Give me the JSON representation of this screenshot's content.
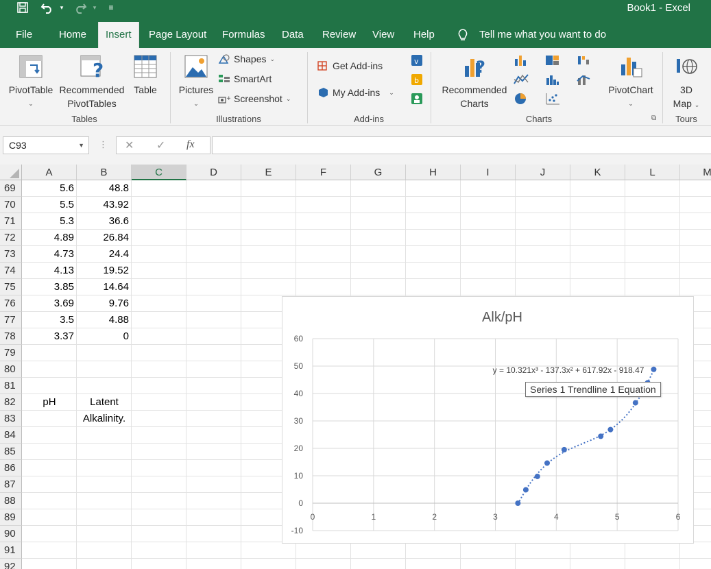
{
  "app": {
    "title": "Book1  -  Excel",
    "accent": "#217346"
  },
  "quick_access": {
    "save_icon": "save-icon",
    "undo_icon": "undo-icon",
    "redo_icon": "redo-icon",
    "customize_icon": "customize-icon"
  },
  "tabs": [
    {
      "label": "File"
    },
    {
      "label": "Home"
    },
    {
      "label": "Insert"
    },
    {
      "label": "Page Layout"
    },
    {
      "label": "Formulas"
    },
    {
      "label": "Data"
    },
    {
      "label": "Review"
    },
    {
      "label": "View"
    },
    {
      "label": "Help"
    }
  ],
  "active_tab": "Insert",
  "tell_me": "Tell me what you want to do",
  "ribbon": {
    "tables": {
      "group_label": "Tables",
      "pivot_table": "PivotTable",
      "recommended_pivot_1": "Recommended",
      "recommended_pivot_2": "PivotTables",
      "table": "Table"
    },
    "illustrations": {
      "group_label": "Illustrations",
      "pictures": "Pictures",
      "shapes": "Shapes",
      "smartart": "SmartArt",
      "screenshot": "Screenshot"
    },
    "addins": {
      "group_label": "Add-ins",
      "get_addins": "Get Add-ins",
      "my_addins": "My Add-ins"
    },
    "charts": {
      "group_label": "Charts",
      "recommended_1": "Recommended",
      "recommended_2": "Charts",
      "pivotchart": "PivotChart"
    },
    "tours": {
      "group_label": "Tours",
      "map_1": "3D",
      "map_2": "Map"
    }
  },
  "formula_bar": {
    "name_box": "C93",
    "cancel_glyph": "✕",
    "enter_glyph": "✓",
    "fx_glyph": "fx",
    "formula": ""
  },
  "columns": [
    "A",
    "B",
    "C",
    "D",
    "E",
    "F",
    "G",
    "H",
    "I",
    "J",
    "K",
    "L",
    "M"
  ],
  "selected_column": "C",
  "rows": [
    {
      "n": "69",
      "a": "5.6",
      "b": "48.8"
    },
    {
      "n": "70",
      "a": "5.5",
      "b": "43.92"
    },
    {
      "n": "71",
      "a": "5.3",
      "b": "36.6"
    },
    {
      "n": "72",
      "a": "4.89",
      "b": "26.84"
    },
    {
      "n": "73",
      "a": "4.73",
      "b": "24.4"
    },
    {
      "n": "74",
      "a": "4.13",
      "b": "19.52"
    },
    {
      "n": "75",
      "a": "3.85",
      "b": "14.64"
    },
    {
      "n": "76",
      "a": "3.69",
      "b": "9.76"
    },
    {
      "n": "77",
      "a": "3.5",
      "b": "4.88"
    },
    {
      "n": "78",
      "a": "3.37",
      "b": "0"
    },
    {
      "n": "79",
      "a": "",
      "b": ""
    },
    {
      "n": "80",
      "a": "",
      "b": ""
    },
    {
      "n": "81",
      "a": "",
      "b": ""
    },
    {
      "n": "82",
      "a": "pH",
      "b": "Latent"
    },
    {
      "n": "83",
      "a": "",
      "b": "Alkalinity."
    },
    {
      "n": "84",
      "a": "",
      "b": ""
    },
    {
      "n": "85",
      "a": "",
      "b": ""
    },
    {
      "n": "86",
      "a": "",
      "b": ""
    },
    {
      "n": "87",
      "a": "",
      "b": ""
    },
    {
      "n": "88",
      "a": "",
      "b": ""
    },
    {
      "n": "89",
      "a": "",
      "b": ""
    },
    {
      "n": "90",
      "a": "",
      "b": ""
    },
    {
      "n": "91",
      "a": "",
      "b": ""
    },
    {
      "n": "92",
      "a": "",
      "b": ""
    }
  ],
  "chart_data": {
    "type": "scatter",
    "title": "Alk/pH",
    "xlabel": "",
    "ylabel": "",
    "xlim": [
      0,
      6
    ],
    "ylim": [
      -10,
      60
    ],
    "x_ticks": [
      "0",
      "1",
      "2",
      "3",
      "4",
      "5",
      "6"
    ],
    "y_ticks": [
      "-10",
      "0",
      "10",
      "20",
      "30",
      "40",
      "50",
      "60"
    ],
    "grid": true,
    "legend": "none",
    "series": [
      {
        "x": [
          5.6,
          5.5,
          5.3,
          4.89,
          4.73,
          4.13,
          3.85,
          3.69,
          3.5,
          3.37
        ],
        "y": [
          48.8,
          43.92,
          36.6,
          26.84,
          24.4,
          19.52,
          14.64,
          9.76,
          4.88,
          0
        ],
        "color": "#4472c4"
      }
    ],
    "trendline": {
      "type": "polynomial-3",
      "coefficients": [
        10.321,
        -137.3,
        617.92,
        -918.47
      ],
      "equation_label": "y = 10.321x³ - 137.3x² + 617.92x - 918.47",
      "style": "dotted",
      "color": "#4472c4"
    },
    "tooltip": "Series 1 Trendline 1 Equation"
  }
}
